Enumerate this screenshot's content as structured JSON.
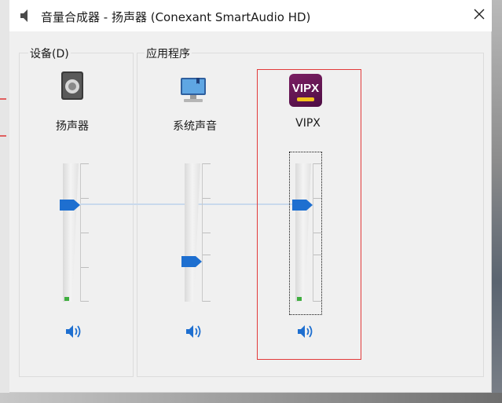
{
  "window": {
    "title": "音量合成器 - 扬声器 (Conexant SmartAudio HD)",
    "close_label": "×"
  },
  "device_group": {
    "label": "设备(D)",
    "device": {
      "name": "扬声器",
      "icon": "speaker-device-icon",
      "volume_level": 0.7
    }
  },
  "apps_group": {
    "label": "应用程序",
    "apps": [
      {
        "name": "系统声音",
        "icon": "system-sounds-icon",
        "volume_level": 0.28
      },
      {
        "name": "VIPX",
        "icon": "vipx-app-icon",
        "logo_text": "VIPX",
        "volume_level": 0.7
      }
    ]
  },
  "colors": {
    "accent": "#1e6fd0",
    "highlight_box": "#e23b3b",
    "level_meter": "#3fae3f"
  }
}
